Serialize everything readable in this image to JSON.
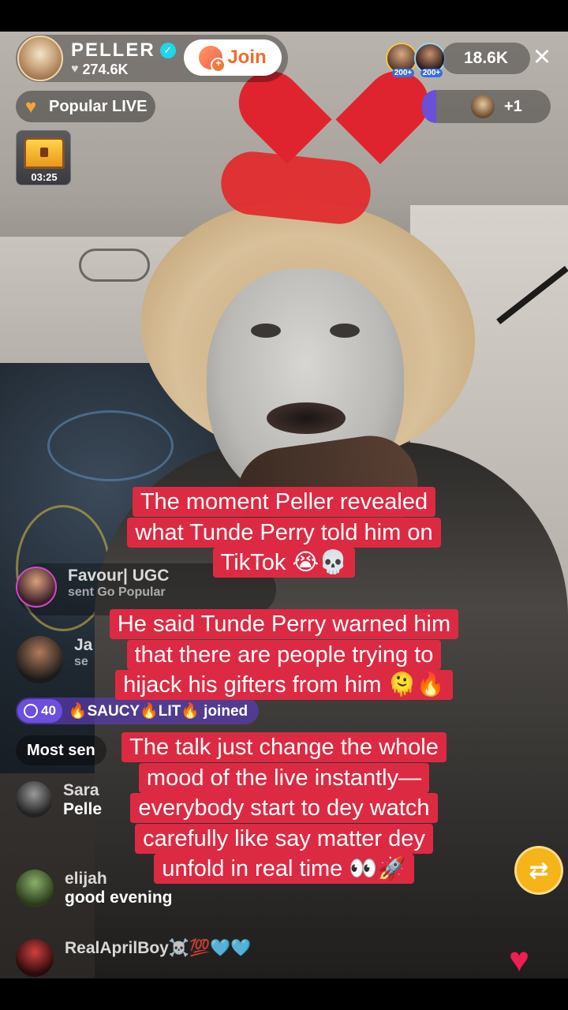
{
  "host": {
    "name": "PELLER",
    "likes": "274.6K",
    "join_label": "Join"
  },
  "viewers": {
    "count": "18.6K",
    "badges": [
      "200+",
      "200+"
    ]
  },
  "popular": {
    "label": "Popular LIVE"
  },
  "guests": {
    "count": "+1"
  },
  "treasure": {
    "timer": "03:25"
  },
  "comments": [
    {
      "user": "Favour| UGC",
      "text": "sent Go Popular"
    },
    {
      "user": "Ja",
      "text": "se"
    },
    {
      "user": "Sara",
      "text": "Pelle"
    },
    {
      "user": "elijah",
      "text": "good evening"
    },
    {
      "user": "RealAprilBoy☠️💯🩵🩵",
      "text": ""
    }
  ],
  "join_event": {
    "level": "40",
    "text": "🔥SAUCY🔥LIT🔥 joined"
  },
  "most_sent": {
    "label": "Most sen"
  },
  "captions": [
    {
      "lines": [
        "The moment Peller revealed",
        "what Tunde Perry told him on",
        "TikTok 😭💀"
      ]
    },
    {
      "lines": [
        "He said Tunde Perry warned him",
        "that there are people trying to",
        "hijack his gifters from him 🫠🔥"
      ]
    },
    {
      "lines": [
        "The talk just change the whole",
        "mood of the live instantly—",
        "everybody start to dey watch",
        "carefully like say matter dey",
        "unfold in real time 👀🚀"
      ]
    }
  ],
  "colors": {
    "caption_bg": "#dd2a43",
    "join_text": "#f26b2a",
    "verified": "#20d5ec",
    "share": "#f5b417",
    "like": "#ee1d52"
  },
  "icons": {
    "close": "×",
    "verified": "✓",
    "heart": "♥",
    "share": "⇄"
  }
}
